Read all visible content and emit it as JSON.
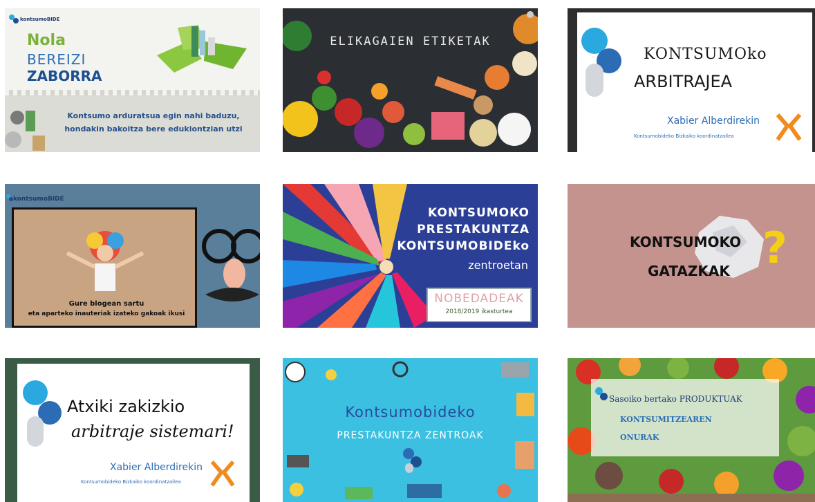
{
  "cards": [
    {
      "id": "zaborra",
      "brand": "kontsumoBIDE",
      "title_line1": "Nola",
      "title_line2": "BEREIZI",
      "title_line3": "ZABORRA",
      "message_line1": "Kontsumo arduratsua egin nahi baduzu,",
      "message_line2": "hondakin bakoitza bere edukiontzian utzi"
    },
    {
      "id": "etiketak",
      "title": "ELIKAGAIEN ETIKETAK"
    },
    {
      "id": "arbitrajea",
      "title_line1": "KONTSUMOko",
      "title_line2": "ARBITRAJEA",
      "name": "Xabier Alberdirekin",
      "subtitle": "Kontsumobideko Bizkaiko koordinatzailea"
    },
    {
      "id": "inauteriak",
      "brand": "kontsumoBIDE",
      "caption_line1": "Gure blogean sartu",
      "caption_line2": "eta aparteko inauteriak izateko gakoak ikusi"
    },
    {
      "id": "prestakuntza",
      "title_line1": "KONTSUMOKO",
      "title_line2": "PRESTAKUNTZA",
      "title_line3": "KONTSUMOBIDEko",
      "title_line4": "zentroetan",
      "sign_title": "NOBEDADEAK",
      "sign_sub": "2018/2019 ikasturtea"
    },
    {
      "id": "gatazkak",
      "title_line1": "KONTSUMOKO",
      "title_line2": "GATAZKAK",
      "symbol": "?"
    },
    {
      "id": "atxiki",
      "title_line1": "Atxiki zakizkio",
      "title_line2": "arbitraje sistemari!",
      "name": "Xabier Alberdirekin",
      "subtitle": "Kontsumobideko Bizkaiko koordinatzailea"
    },
    {
      "id": "zentroak",
      "title_line1": "Kontsumobideko",
      "title_line2": "PRESTAKUNTZA ZENTROAK"
    },
    {
      "id": "produktuak",
      "title_line1": "Sasoiko bertako PRODUKTUAK",
      "title_line2": "KONTSUMITZEAREN",
      "title_line3": "ONURAK"
    }
  ],
  "colors": {
    "brand_blue": "#2b6cb5",
    "brand_cyan": "#29a9e0",
    "accent_yellow": "#f4d013",
    "accent_orange": "#f08c1e"
  }
}
